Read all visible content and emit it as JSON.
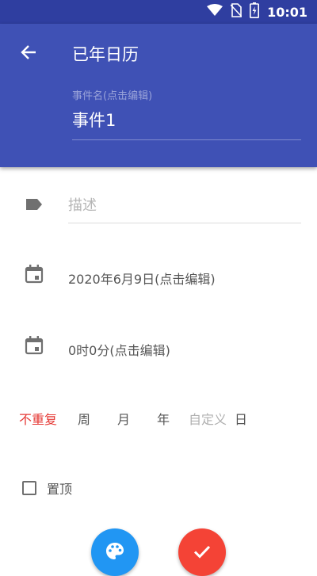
{
  "status_bar": {
    "time": "10:01",
    "icons": [
      "wifi-icon",
      "no-sim-icon",
      "battery-charging-icon"
    ],
    "background": "#2f3ea0"
  },
  "app_bar": {
    "title": "已年日历",
    "background": "#3f51b5",
    "event_name_hint": "事件名(点击编辑)",
    "event_name_value": "事件1"
  },
  "form": {
    "description_placeholder": "描述",
    "date_text": "2020年6月9日(点击编辑)",
    "time_text": "0时0分(点击编辑)",
    "repeat_options": {
      "none": "不重复",
      "week": "周",
      "month": "月",
      "year": "年",
      "custom": "自定义",
      "day": "日"
    },
    "repeat_selected": "不重复",
    "pin_label": "置顶",
    "pin_checked": false
  },
  "colors": {
    "accent": "#3f51b5",
    "active_option": "#e53935",
    "palette_fab": "#2196f3",
    "confirm_fab": "#f44336"
  },
  "actions": {
    "palette_icon": "palette-icon",
    "confirm_icon": "check-icon"
  }
}
